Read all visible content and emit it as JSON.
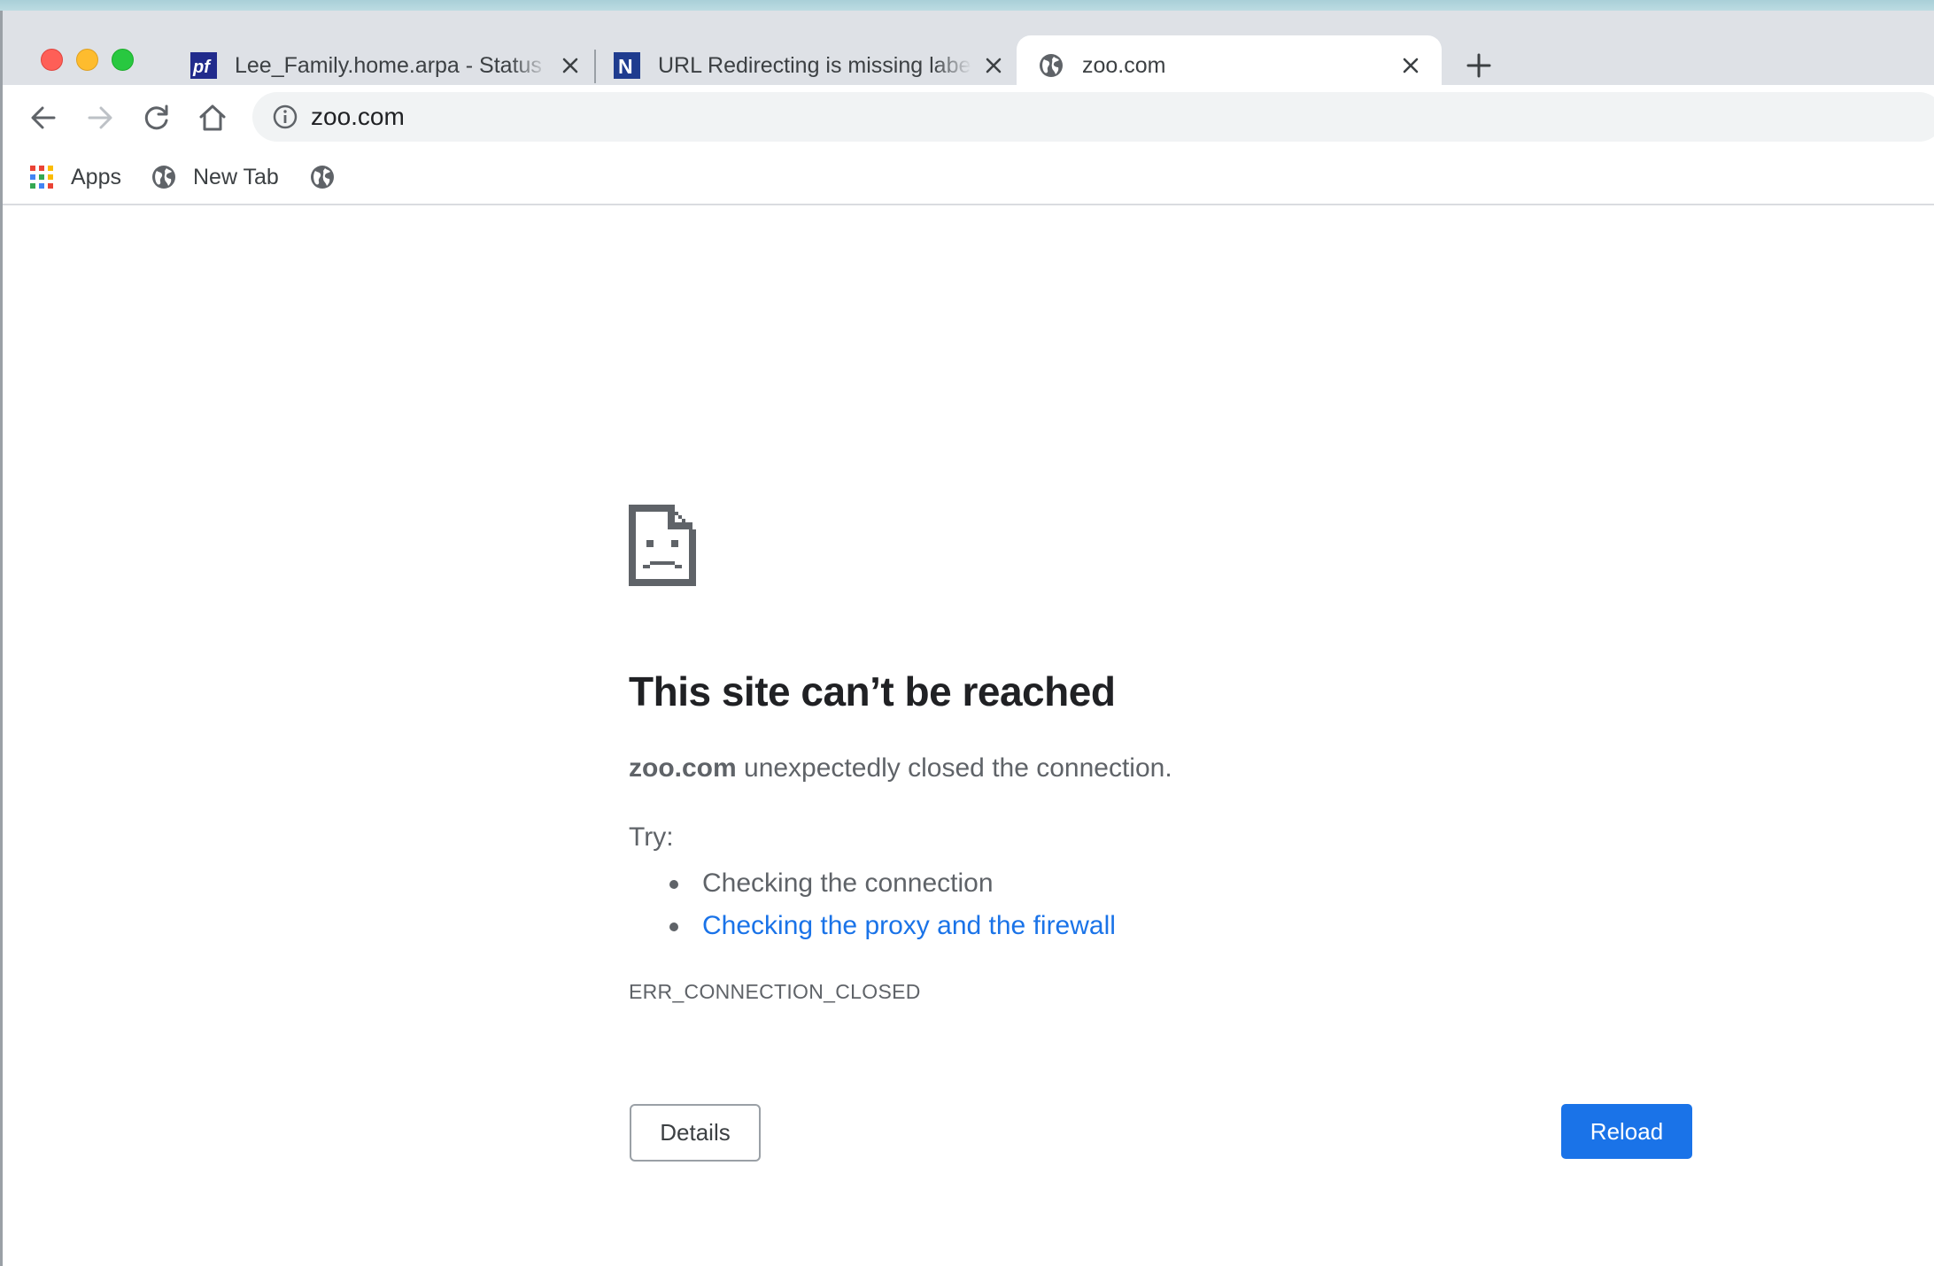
{
  "window": {
    "controls": [
      "close",
      "minimize",
      "zoom"
    ]
  },
  "tabs": [
    {
      "title": "Lee_Family.home.arpa - Status",
      "favicon": "pfsense-icon",
      "active": false
    },
    {
      "title": "URL Redirecting is missing labels",
      "favicon": "n-brand-icon",
      "active": false
    },
    {
      "title": "zoo.com",
      "favicon": "globe-icon",
      "active": true
    }
  ],
  "toolbar": {
    "url": "zoo.com",
    "back_enabled": true,
    "forward_enabled": false
  },
  "bookmarks": [
    {
      "label": "Apps",
      "icon": "apps-grid-icon"
    },
    {
      "label": "New Tab",
      "icon": "globe-icon"
    },
    {
      "label": "",
      "icon": "globe-icon"
    }
  ],
  "error_page": {
    "icon": "sad-page-icon",
    "headline": "This site can’t be reached",
    "host": "zoo.com",
    "summary_rest": " unexpectedly closed the connection.",
    "try_label": "Try:",
    "suggestions": [
      {
        "text": "Checking the connection",
        "is_link": false
      },
      {
        "text": "Checking the proxy and the firewall",
        "is_link": true
      }
    ],
    "error_code": "ERR_CONNECTION_CLOSED",
    "details_button": "Details",
    "reload_button": "Reload"
  },
  "colors": {
    "tabstrip_bg": "#dee1e6",
    "omnibox_bg": "#f1f3f4",
    "link": "#1a73e8",
    "primary_button": "#1a73e8",
    "text_secondary": "#5f6368",
    "text_primary": "#202124"
  }
}
